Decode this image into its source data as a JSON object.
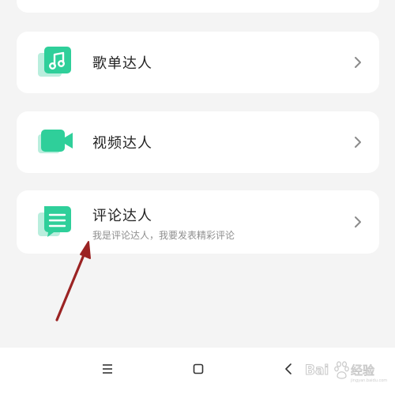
{
  "menu": {
    "items": [
      {
        "label": "歌单达人",
        "icon": "music-playlist-icon"
      },
      {
        "label": "视频达人",
        "icon": "video-camera-icon"
      },
      {
        "label": "评论达人",
        "subtitle": "我是评论达人，我要发表精彩评论",
        "icon": "comment-note-icon"
      }
    ]
  },
  "nav": {
    "menu_icon": "menu-lines-icon",
    "home_icon": "home-square-icon",
    "back_icon": "back-chevron-icon"
  },
  "watermark": {
    "text": "Baidu经验"
  },
  "colors": {
    "accent": "#2fcf9a",
    "accent_light": "#b9eedd",
    "arrow": "#9b2323",
    "background": "#f4f4f4",
    "card": "#ffffff"
  }
}
